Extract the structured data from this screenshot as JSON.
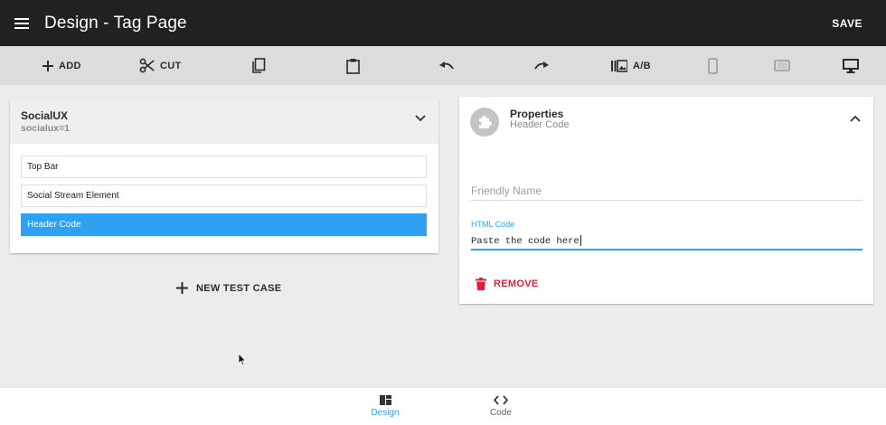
{
  "app": {
    "title": "Design - Tag Page",
    "save_label": "SAVE"
  },
  "toolbar": {
    "add_label": "ADD",
    "cut_label": "CUT",
    "ab_label": "A/B",
    "icons": [
      "add-icon",
      "cut-icon",
      "copy-icon",
      "paste-icon",
      "undo-icon",
      "redo-icon",
      "ab-test-icon",
      "phone-icon",
      "tablet-icon",
      "desktop-icon"
    ]
  },
  "tag": {
    "name": "SocialUX",
    "param": "socialux=1",
    "items": [
      {
        "label": "Top Bar",
        "selected": false
      },
      {
        "label": "Social Stream Element",
        "selected": false
      },
      {
        "label": "Header Code",
        "selected": true
      }
    ],
    "new_test_case_label": "NEW TEST CASE"
  },
  "properties": {
    "title": "Properties",
    "subtitle": "Header Code",
    "friendly_name_placeholder": "Friendly Name",
    "html_code_label": "HTML Code",
    "html_code_value": "Paste the code here",
    "remove_label": "REMOVE"
  },
  "bottom_nav": {
    "items": [
      {
        "label": "Design",
        "icon": "dashboard-icon",
        "active": true
      },
      {
        "label": "Code",
        "icon": "code-icon",
        "active": false
      }
    ]
  },
  "colors": {
    "appbar": "#212121",
    "accent": "#2ea1f2",
    "danger": "#e01e3c",
    "toolbar": "#dcdcdc"
  }
}
